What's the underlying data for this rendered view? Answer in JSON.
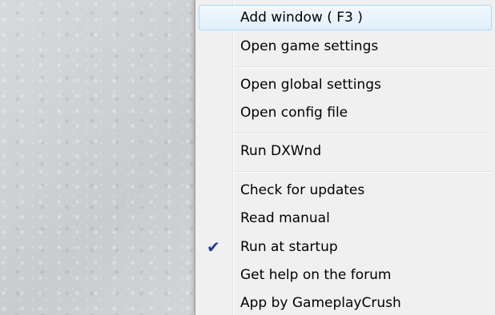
{
  "menu": {
    "items": [
      {
        "label": "Add window ( F3 )"
      },
      {
        "label": "Open game settings"
      },
      {
        "label": "Open global settings"
      },
      {
        "label": "Open config file"
      },
      {
        "label": "Run DXWnd"
      },
      {
        "label": "Check for updates"
      },
      {
        "label": "Read manual"
      },
      {
        "label": "Run at startup",
        "checked": true,
        "check_icon": "✔"
      },
      {
        "label": "Get help on the forum"
      },
      {
        "label": "App by GameplayCrush"
      }
    ],
    "highlighted_item": "Add window ( F3 )"
  },
  "colors": {
    "menu_background": "#f0f0f0",
    "highlight_border": "#a8d8f8",
    "checkmark": "#1f3a9e"
  }
}
